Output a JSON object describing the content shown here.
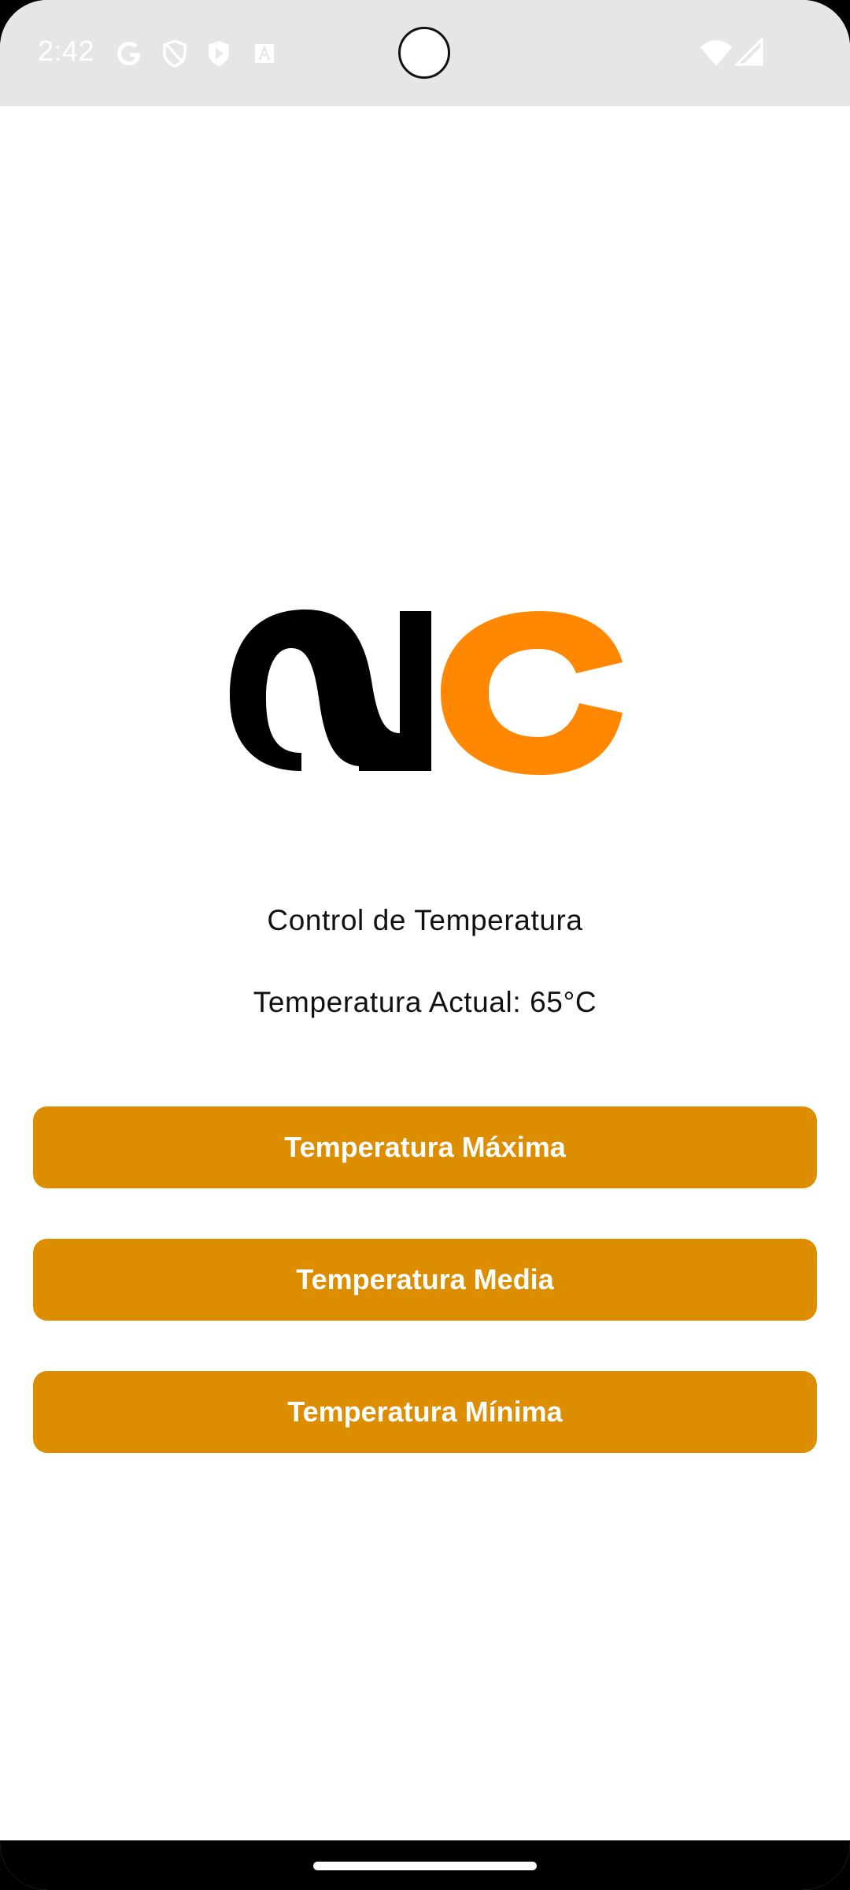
{
  "status_bar": {
    "time": "2:42",
    "icons": [
      "google-icon",
      "shield-icon",
      "play-protect-icon",
      "font-icon",
      "wifi-icon",
      "signal-icon"
    ]
  },
  "logo": {
    "name": "ac-logo",
    "colors": {
      "dark": "#000000",
      "accent": "#ff8800"
    }
  },
  "main": {
    "title": "Control de Temperatura",
    "current_temperature": "Temperatura Actual: 65°C"
  },
  "buttons": {
    "max_label": "Temperatura Máxima",
    "med_label": "Temperatura Media",
    "min_label": "Temperatura Mínima"
  },
  "colors": {
    "button": "#dc8d00",
    "status_bar": "#e6e6e6",
    "background": "#ffffff"
  }
}
